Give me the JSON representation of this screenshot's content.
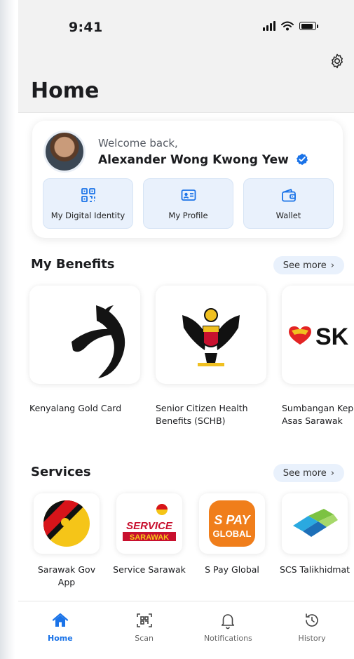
{
  "status_bar": {
    "time": "9:41"
  },
  "header": {
    "title": "Home",
    "settings_icon": "gear-icon"
  },
  "profile": {
    "welcome": "Welcome back,",
    "name": "Alexander Wong Kwong Yew",
    "verified_icon": "verified-badge-icon",
    "actions": [
      {
        "label": "My Digital Identity",
        "icon": "qr-code-icon"
      },
      {
        "label": "My Profile",
        "icon": "id-card-icon"
      },
      {
        "label": "Wallet",
        "icon": "wallet-icon"
      }
    ]
  },
  "benefits": {
    "title": "My Benefits",
    "see_more": "See more",
    "items": [
      {
        "label": "Kenyalang Gold Card"
      },
      {
        "label": "Senior Citizen Health Benefits (SCHB)"
      },
      {
        "label": "Sumbangan Keperluan Asas Sarawak",
        "logo_text": "SK"
      }
    ]
  },
  "services": {
    "title": "Services",
    "see_more": "See more",
    "items": [
      {
        "label": "Sarawak Gov App"
      },
      {
        "label": "Service Sarawak",
        "logo_text_1": "SERVICE",
        "logo_text_2": "SARAWAK"
      },
      {
        "label": "S Pay Global",
        "logo_text_1": "S PAY",
        "logo_text_2": "GLOBAL"
      },
      {
        "label": "SCS Talikhidmat"
      }
    ]
  },
  "nav": [
    {
      "label": "Home",
      "icon": "home-icon",
      "active": true
    },
    {
      "label": "Scan",
      "icon": "scan-icon"
    },
    {
      "label": "Notifications",
      "icon": "bell-icon"
    },
    {
      "label": "History",
      "icon": "history-icon"
    }
  ],
  "colors": {
    "accent": "#1a73e8",
    "chip_bg": "#e9f1fc"
  }
}
